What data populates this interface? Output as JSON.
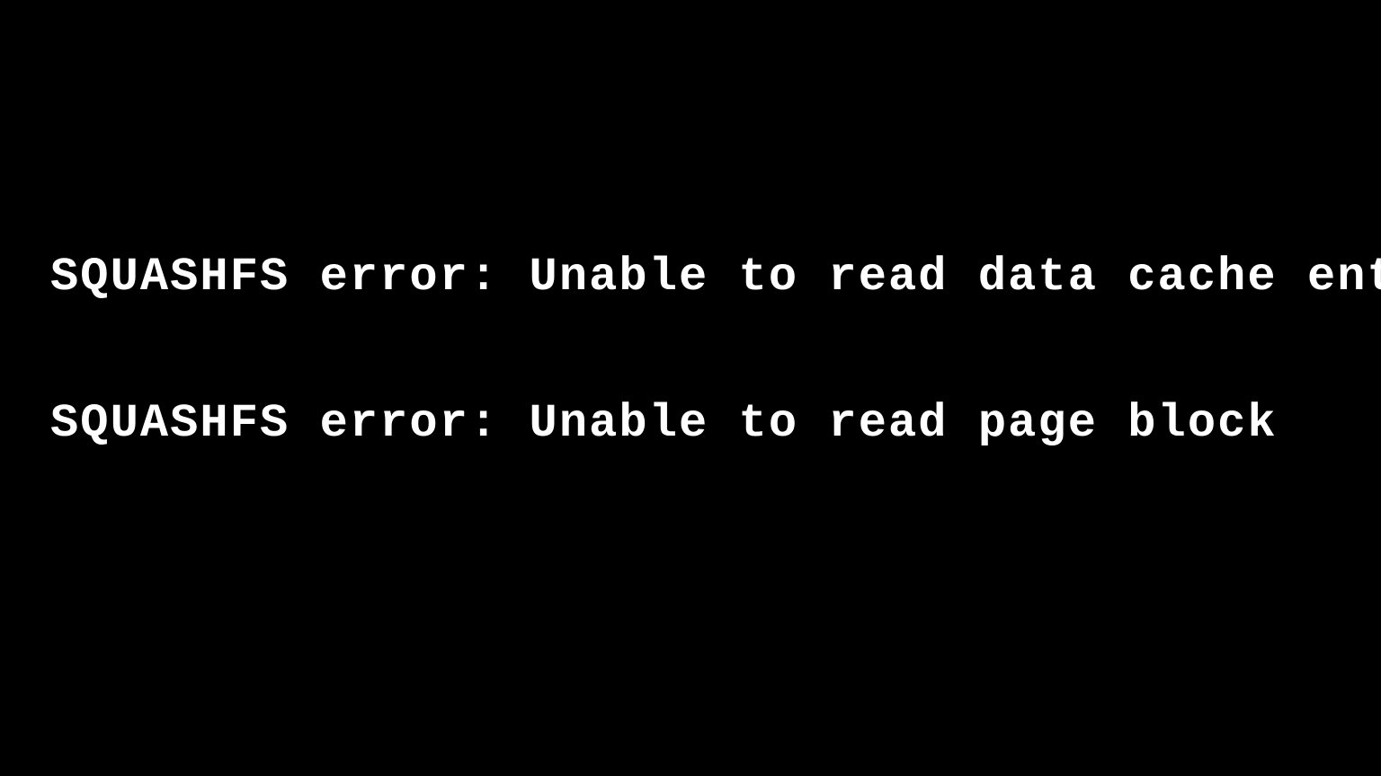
{
  "console": {
    "lines": [
      "SQUASHFS error: Unable to read data cache entry",
      "SQUASHFS error: Unable to read page block"
    ]
  }
}
